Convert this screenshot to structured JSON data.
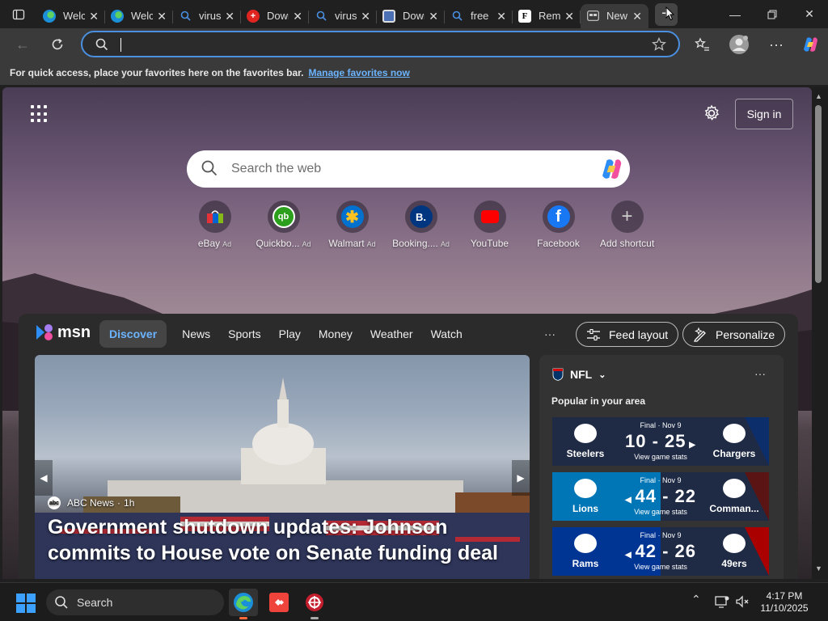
{
  "tabs": [
    {
      "title": "Welcome",
      "favicon": "edge-icon",
      "fav_color": "#1b8fd8",
      "active": false
    },
    {
      "title": "Welcome",
      "favicon": "edge-icon",
      "fav_color": "#1b8fd8",
      "active": false
    },
    {
      "title": "virus",
      "favicon": "search-icon",
      "fav_color": "#3a7bd5",
      "active": false
    },
    {
      "title": "Download",
      "favicon": "swiss-cross-icon",
      "fav_color": "#e0241f",
      "active": false
    },
    {
      "title": "virus",
      "favicon": "search-icon",
      "fav_color": "#3a7bd5",
      "active": false
    },
    {
      "title": "Download",
      "favicon": "document-icon",
      "fav_color": "#4a6fb5",
      "active": false
    },
    {
      "title": "free",
      "favicon": "search-icon",
      "fav_color": "#3a7bd5",
      "active": false
    },
    {
      "title": "Remove",
      "favicon": "f-letter-icon",
      "fav_color": "#000000",
      "active": false
    },
    {
      "title": "New tab",
      "favicon": "newtab-icon",
      "fav_color": "#cccccc",
      "active": true
    }
  ],
  "address_bar": {
    "value": "",
    "placeholder": ""
  },
  "favorites_bar": {
    "text": "For quick access, place your favorites here on the favorites bar.",
    "link": "Manage favorites now"
  },
  "header": {
    "sign_in": "Sign in"
  },
  "web_search": {
    "placeholder": "Search the web"
  },
  "shortcuts": [
    {
      "label": "eBay",
      "ad": "Ad",
      "icon": "ebay-bag-icon",
      "color": "#e53238"
    },
    {
      "label": "Quickbo...",
      "ad": "Ad",
      "icon": "quickbooks-icon",
      "color": "#2ca01c"
    },
    {
      "label": "Walmart",
      "ad": "Ad",
      "icon": "walmart-spark-icon",
      "color": "#0071ce"
    },
    {
      "label": "Booking....",
      "ad": "Ad",
      "icon": "booking-icon",
      "color": "#003580"
    },
    {
      "label": "YouTube",
      "ad": "",
      "icon": "youtube-icon",
      "color": "#ff0000"
    },
    {
      "label": "Facebook",
      "ad": "",
      "icon": "facebook-icon",
      "color": "#1877f2"
    },
    {
      "label": "Add shortcut",
      "ad": "",
      "icon": "plus-icon",
      "color": "#5c5c5c"
    }
  ],
  "msn": {
    "logo": "msn",
    "nav": [
      "Discover",
      "News",
      "Sports",
      "Play",
      "Money",
      "Weather",
      "Watch"
    ],
    "more": "···",
    "feed_layout": "Feed layout",
    "personalize": "Personalize"
  },
  "hero": {
    "source": "ABC News",
    "age": "1h",
    "source_logo_text": "abc",
    "headline": "Government shutdown updates: Johnson commits to House vote on Senate funding deal"
  },
  "nfl": {
    "title": "NFL",
    "subtitle": "Popular in your area",
    "more": "···",
    "games": [
      {
        "status": "Final · Nov 9",
        "score": "10 - 25",
        "link": "View game stats",
        "home": "Steelers",
        "away": "Chargers",
        "home_color": "#1f2a44",
        "away_color": "#0c2e6b",
        "arrow": "right"
      },
      {
        "status": "Final · Nov 9",
        "score": "44 - 22",
        "link": "View game stats",
        "home": "Lions",
        "away": "Comman...",
        "home_color": "#0076b6",
        "away_color": "#5a1414",
        "arrow": "left"
      },
      {
        "status": "Final · Nov 9",
        "score": "42 - 26",
        "link": "View game stats",
        "home": "Rams",
        "away": "49ers",
        "home_color": "#003594",
        "away_color": "#aa0000",
        "arrow": "left"
      }
    ]
  },
  "taskbar": {
    "search": "Search",
    "time": "4:17 PM",
    "date": "11/10/2025"
  }
}
